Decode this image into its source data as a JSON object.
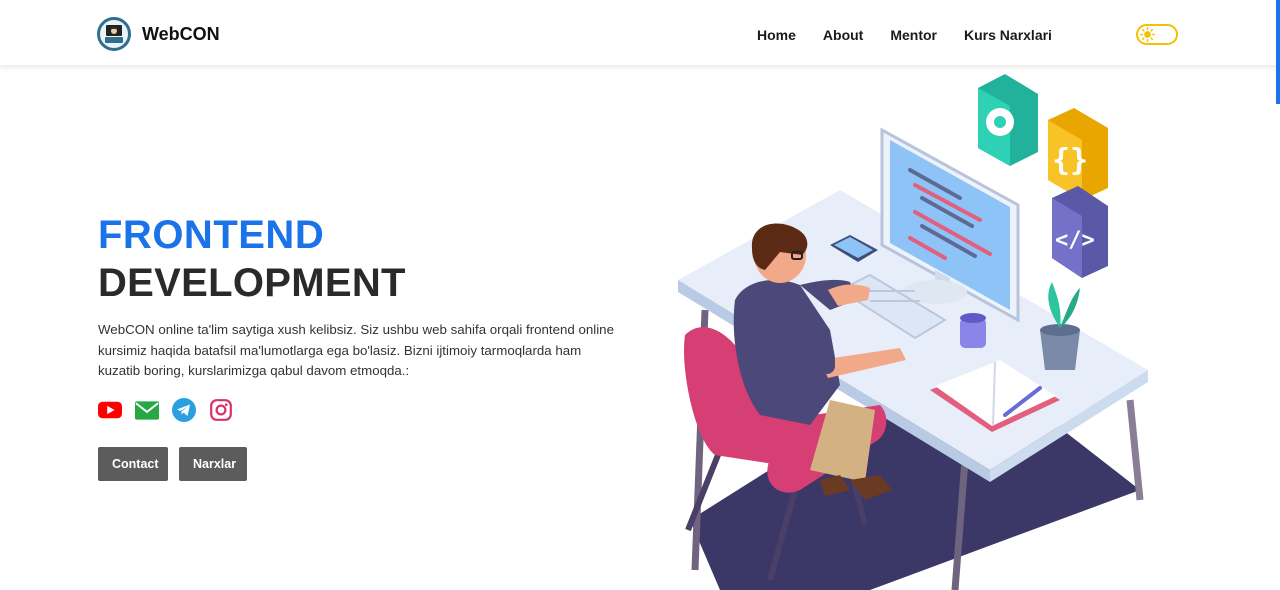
{
  "nav": {
    "brand": "WebCON",
    "links": [
      "Home",
      "About",
      "Mentor",
      "Kurs Narxlari"
    ],
    "theme_toggle_icon": "sun-icon"
  },
  "hero": {
    "title_line1": "FRONTEND",
    "title_line2": "DEVELOPMENT",
    "description": "WebCON online ta'lim saytiga xush kelibsiz. Siz ushbu web sahifa orqali frontend online kursimiz haqida batafsil ma'lumotlarga ega bo'lasiz. Bizni ijtimoiy tarmoqlarda ham kuzatib boring, kurslarimizga qabul davom etmoqda.:",
    "socials": [
      {
        "icon": "youtube-icon",
        "color": "#ff0000"
      },
      {
        "icon": "email-icon",
        "color": "#27a844"
      },
      {
        "icon": "telegram-icon",
        "color": "#2aa1de"
      },
      {
        "icon": "instagram-icon",
        "color": "#d6336c"
      }
    ],
    "buttons": {
      "contact": "Contact",
      "narxlar": "Narxlar"
    }
  },
  "colors": {
    "accent": "#1a73e8",
    "button_bg": "#5c5c5c",
    "toggle": "#f2c200"
  }
}
